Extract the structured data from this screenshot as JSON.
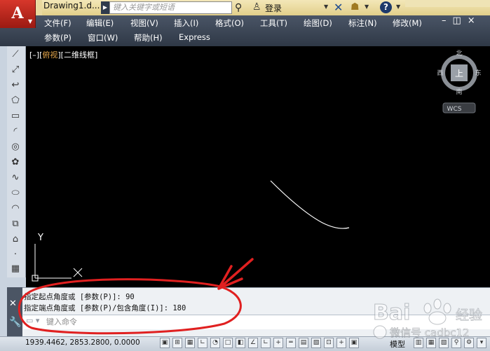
{
  "title_bar": {
    "app_logo": "A",
    "document_title": "Drawing1.d...",
    "search_placeholder": "键入关键字或短语",
    "login_label": "登录",
    "help_symbol": "?"
  },
  "menu_bar": {
    "row1": [
      "文件(F)",
      "编辑(E)",
      "视图(V)",
      "插入(I)",
      "格式(O)",
      "工具(T)",
      "绘图(D)",
      "标注(N)",
      "修改(M)"
    ],
    "row2": [
      "参数(P)",
      "窗口(W)",
      "帮助(H)",
      "Express"
    ],
    "mdi_controls": "–◫×"
  },
  "viewport": {
    "label_prefix": "[–][",
    "view_name": "俯视",
    "label_suffix": "][二维线框]"
  },
  "viewcube": {
    "north": "北",
    "south": "南",
    "east": "东",
    "west": "西",
    "face": "上",
    "wcs_label": "WCS"
  },
  "ucs": {
    "y_label": "Y"
  },
  "command_window": {
    "history": [
      "指定起点角度或 [参数(P)]: 90",
      "指定端点角度或 [参数(P)/包含角度(I)]: 180"
    ],
    "input_placeholder": "键入命令"
  },
  "status_bar": {
    "coordinates": "1939.4462, 2853.2800, 0.0000",
    "model_label": "模型"
  },
  "watermark": {
    "brand": "Bai",
    "brand_suffix": "经验",
    "account": "微信号 cadbc12"
  },
  "colors": {
    "title_bar": "#e8d89a",
    "menu_bar": "#3a4453",
    "canvas": "#000000",
    "annotation_red": "#e02020",
    "viewport_highlight": "#e3a54a"
  }
}
